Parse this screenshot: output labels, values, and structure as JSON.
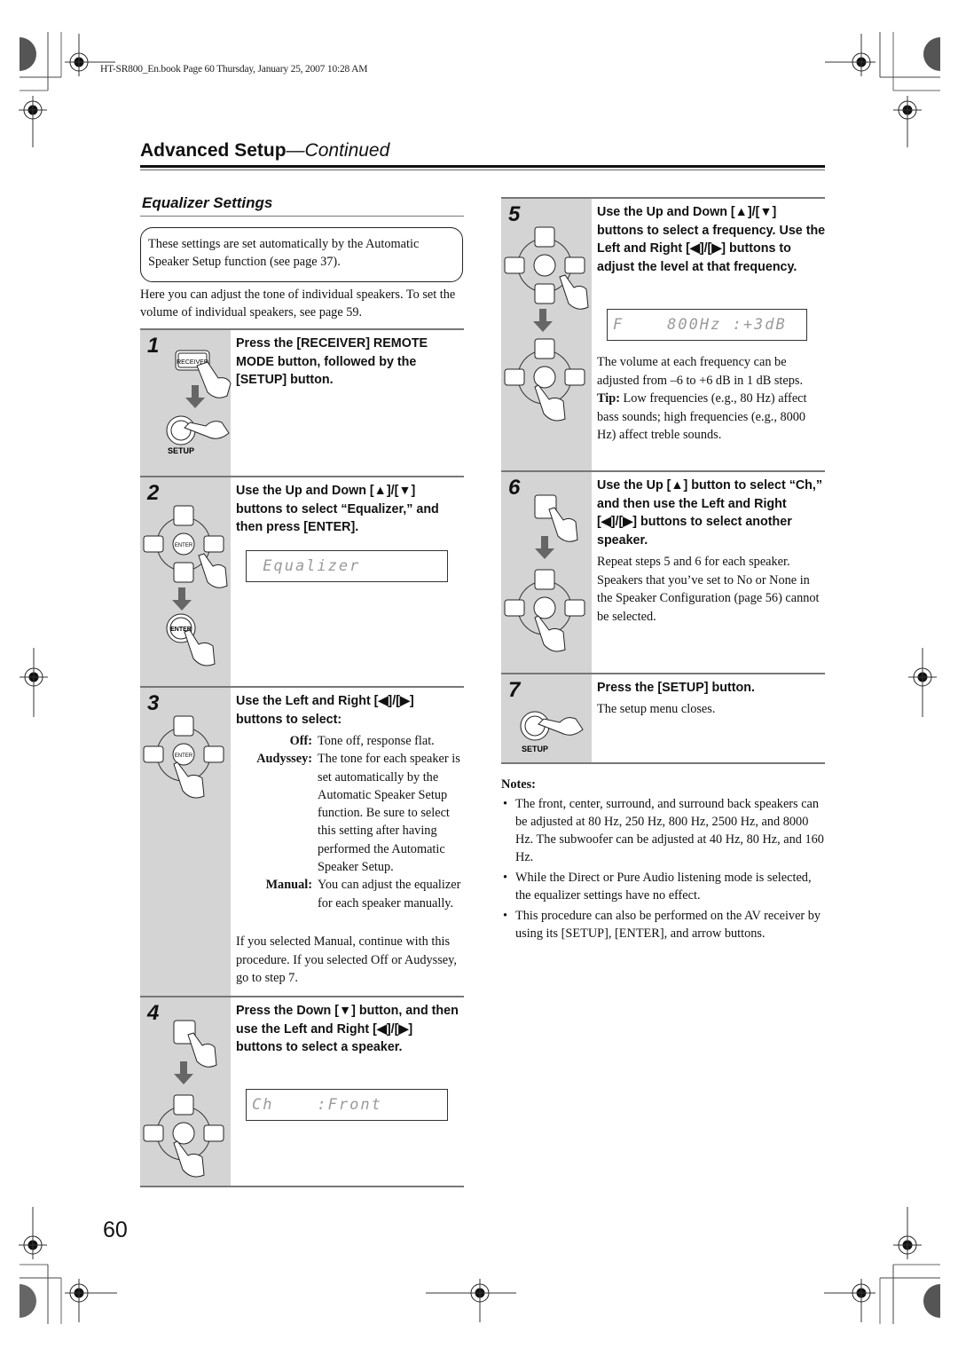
{
  "header": {
    "book_line": "HT-SR800_En.book  Page 60  Thursday, January 25, 2007   10:28 AM",
    "title_bold": "Advanced Setup",
    "title_italic": "—Continued"
  },
  "section": {
    "title": "Equalizer Settings",
    "callout": "These settings are set automatically by the Automatic Speaker Setup function (see page 37).",
    "intro": "Here you can adjust the tone of individual speakers. To set the volume of individual speakers, see page 59."
  },
  "steps": [
    {
      "number": "1",
      "heading": "Press the [RECEIVER] REMOTE MODE button, followed by the [SETUP] button.",
      "icons": {
        "receiver_label": "RECEIVER",
        "setup_label": "SETUP"
      }
    },
    {
      "number": "2",
      "heading": "Use the Up and Down [▲]/[▼] buttons to select “Equalizer,” and then press [ENTER].",
      "display": " Equalizer",
      "icons": {
        "enter_label": "ENTER"
      }
    },
    {
      "number": "3",
      "heading": "Use the Left and Right [◀]/[▶] buttons to select:",
      "options": [
        {
          "key": "Off:",
          "desc": "Tone off, response flat."
        },
        {
          "key": "Audyssey:",
          "desc": "The tone for each speaker is set automatically by the Automatic Speaker Setup function. Be sure to select this setting after having performed the Automatic Speaker Setup."
        },
        {
          "key": "Manual:",
          "desc": "You can adjust the equalizer for each speaker manually."
        }
      ],
      "after": "If you selected Manual, continue with this procedure. If you selected Off or Audyssey, go to step 7."
    },
    {
      "number": "4",
      "heading": "Press the Down [▼] button, and then use the Left and Right [◀]/[▶] buttons to select a speaker.",
      "display": "Ch    :Front"
    },
    {
      "number": "5",
      "heading": "Use the Up and Down [▲]/[▼] buttons to select a frequency. Use the Left and Right [◀]/[▶] buttons to adjust the level at that frequency.",
      "display": "F    800Hz :+3dB",
      "body": "The volume at each frequency can be adjusted from –6 to +6 dB in 1 dB steps.",
      "tip_label": "Tip:",
      "tip": " Low frequencies (e.g., 80 Hz) affect bass sounds; high frequencies (e.g., 8000 Hz) affect treble sounds."
    },
    {
      "number": "6",
      "heading": "Use the Up [▲] button to select “Ch,” and then use the Left and Right [◀]/[▶] buttons to select another speaker.",
      "body": "Repeat steps 5 and 6 for each speaker. Speakers that you’ve set to No or None in the Speaker Configuration (page 56) cannot be selected."
    },
    {
      "number": "7",
      "heading": "Press the [SETUP] button.",
      "body": "The setup menu closes.",
      "icons": {
        "setup_label": "SETUP"
      }
    }
  ],
  "notes": {
    "title": "Notes:",
    "items": [
      "The front, center, surround, and surround back speakers can be adjusted at 80 Hz, 250 Hz, 800 Hz, 2500 Hz, and 8000 Hz. The subwoofer can be adjusted at 40 Hz, 80 Hz, and 160 Hz.",
      "While the Direct or Pure Audio listening mode is selected, the equalizer settings have no effect.",
      "This procedure can also be performed on the AV receiver by using its [SETUP], [ENTER], and arrow buttons."
    ]
  },
  "footer": {
    "page_number": "60"
  }
}
